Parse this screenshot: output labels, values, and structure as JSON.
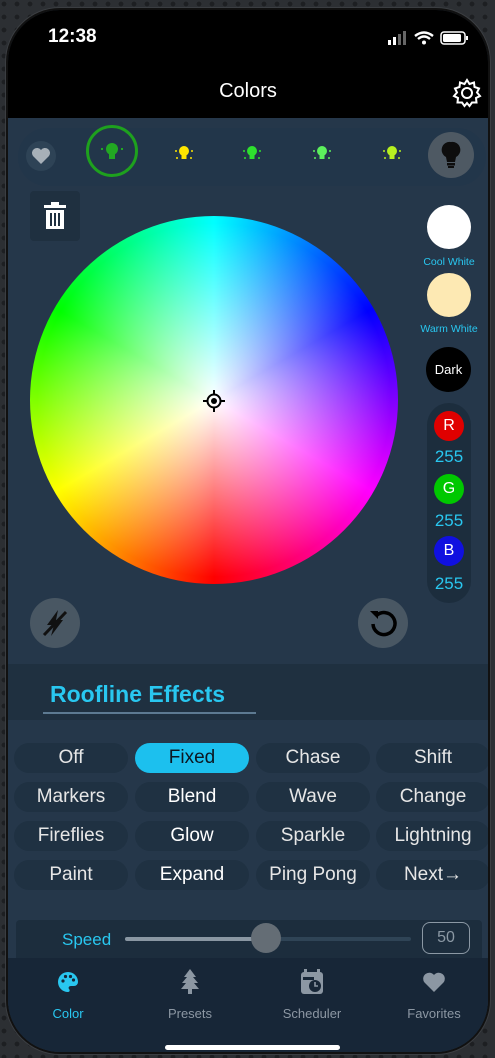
{
  "status": {
    "time": "12:38"
  },
  "header": {
    "title": "Colors"
  },
  "swatches": {
    "cool_white": "Cool White",
    "warm_white": "Warm White",
    "dark": "Dark"
  },
  "rgb": {
    "r_label": "R",
    "r_value": "255",
    "g_label": "G",
    "g_value": "255",
    "b_label": "B",
    "b_value": "255"
  },
  "effects": {
    "title": "Roofline Effects",
    "buttons": [
      "Off",
      "Fixed",
      "Chase",
      "Shift",
      "Markers",
      "Blend",
      "Wave",
      "Change",
      "Fireflies",
      "Glow",
      "Sparkle",
      "Lightning",
      "Paint",
      "Expand",
      "Ping Pong",
      "Next→"
    ],
    "selected": "Fixed"
  },
  "speed": {
    "label": "Speed",
    "value": "50",
    "level_fraction": 0.5
  },
  "tabs": [
    {
      "label": "Color",
      "icon": "palette-icon",
      "active": true
    },
    {
      "label": "Presets",
      "icon": "tree-icon",
      "active": false
    },
    {
      "label": "Scheduler",
      "icon": "calendar-clock-icon",
      "active": false
    },
    {
      "label": "Favorites",
      "icon": "heart-icon",
      "active": false
    }
  ],
  "colors": {
    "accent": "#29c7f0",
    "selected_bulb_ring": "#1ea11e",
    "background": "#25374a"
  }
}
